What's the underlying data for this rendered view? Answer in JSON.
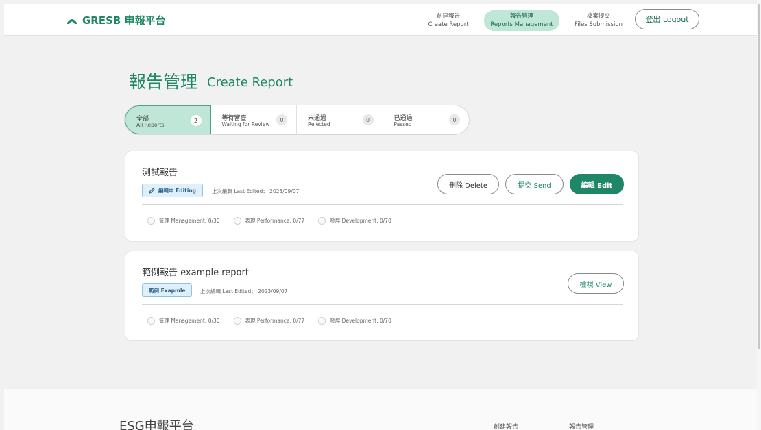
{
  "header": {
    "logo_text": "GRESB 申報平台",
    "nav": [
      {
        "zh": "創建報告",
        "en": "Create Report",
        "active": false
      },
      {
        "zh": "報告管理",
        "en": "Reports Management",
        "active": true
      },
      {
        "zh": "檔案提交",
        "en": "Files Submission",
        "active": false
      }
    ],
    "logout_label": "登出 Logout"
  },
  "page": {
    "title": "報告管理",
    "subtitle": "Create Report"
  },
  "tabs": [
    {
      "zh": "全部",
      "en": "All Reports",
      "count": "2",
      "active": true
    },
    {
      "zh": "等待審查",
      "en": "Waiting for Review",
      "count": "0",
      "active": false
    },
    {
      "zh": "未通過",
      "en": "Rejected",
      "count": "0",
      "active": false
    },
    {
      "zh": "已通過",
      "en": "Passed",
      "count": "0",
      "active": false
    }
  ],
  "reports": [
    {
      "title": "測試報告",
      "badge": "編輯中 Editing",
      "last_edited": "上次編輯 Last Edited： 2023/09/07",
      "progress": [
        {
          "label": "管理 Management: 0/30"
        },
        {
          "label": "表現 Performance: 0/77"
        },
        {
          "label": "發展 Development: 0/70"
        }
      ],
      "buttons": {
        "delete": "刪除 Delete",
        "send": "提交 Send",
        "edit": "編輯 Edit"
      }
    },
    {
      "title": "範例報告 example report",
      "badge": "範例 Exapmle",
      "last_edited": "上次編輯 Last Edited： 2023/09/07",
      "progress": [
        {
          "label": "管理 Management: 0/30"
        },
        {
          "label": "表現 Performance: 0/77"
        },
        {
          "label": "發展 Development: 0/70"
        }
      ],
      "buttons": {
        "view": "檢視 View"
      }
    }
  ],
  "footer": {
    "title": "ESG申報平台",
    "links": [
      "創建報告",
      "報告管理"
    ]
  },
  "colors": {
    "brand": "#1f8766",
    "active_bg": "#bfe6d6",
    "badge_bg": "#dff0fb",
    "page_bg": "#f1f1f1"
  },
  "icons": {
    "logo": "arch-logo-icon",
    "badge": "pencil-icon"
  }
}
